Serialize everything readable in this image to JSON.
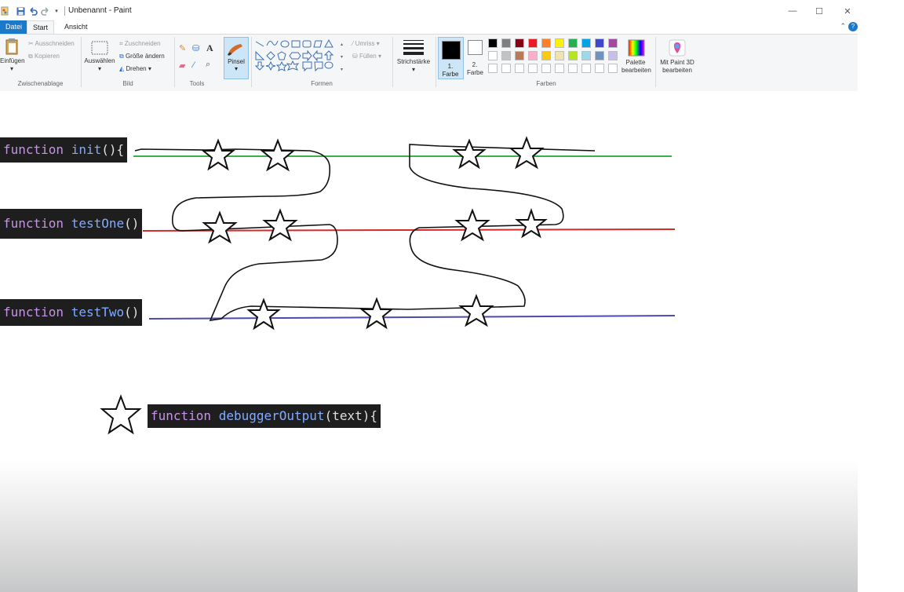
{
  "window": {
    "title": "Unbenannt - Paint",
    "controls": {
      "minimize": "—",
      "maximize": "☐",
      "close": "✕"
    }
  },
  "tabs": [
    "Datei",
    "Start",
    "Ansicht"
  ],
  "ribbon": {
    "clipboard": {
      "paste": "Einfügen",
      "cut": "Ausschneiden",
      "copy": "Kopieren",
      "group": "Zwischenablage"
    },
    "image": {
      "select": "Auswählen",
      "crop": "Zuschneiden",
      "resize": "Größe ändern",
      "rotate": "Drehen",
      "group": "Bild"
    },
    "tools": {
      "group": "Tools"
    },
    "brush": {
      "label": "Pinsel"
    },
    "shapes": {
      "outline": "Umriss",
      "fill": "Füllen",
      "group": "Formen"
    },
    "stroke": {
      "label": "Strichstärke"
    },
    "colors": {
      "color1": "1. Farbe",
      "color2": "2. Farbe",
      "group": "Farben",
      "edit": "Palette bearbeiten",
      "paint3d": "Mit Paint 3D bearbeiten",
      "palette_row1": [
        "#000000",
        "#7f7f7f",
        "#880015",
        "#ed1c24",
        "#ff7f27",
        "#fff200",
        "#22b14c",
        "#00a2e8",
        "#3f48cc",
        "#a349a4"
      ],
      "palette_row2": [
        "#ffffff",
        "#c3c3c3",
        "#b97a57",
        "#ffaec9",
        "#ffc90e",
        "#efe4b0",
        "#b5e61d",
        "#99d9ea",
        "#7092be",
        "#c8bfe7"
      ]
    }
  },
  "canvas": {
    "snippets": [
      {
        "keyword": "function",
        "name": "init",
        "rest": "(){"
      },
      {
        "keyword": "function",
        "name": "testOne",
        "rest": "()"
      },
      {
        "keyword": "function",
        "name": "testTwo",
        "rest": "()"
      },
      {
        "keyword": "function",
        "name": "debuggerOutput",
        "rest": "(text){"
      }
    ],
    "line_colors": {
      "init": "#3cb04a",
      "testOne": "#d42a2a",
      "testTwo": "#4b4bb0"
    }
  }
}
